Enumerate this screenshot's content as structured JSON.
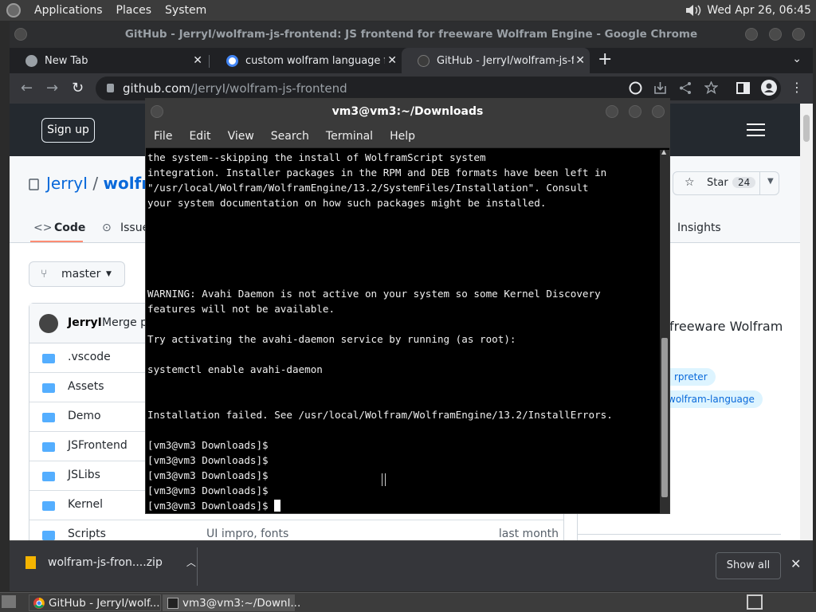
{
  "top_panel": {
    "menus": [
      "Applications",
      "Places",
      "System"
    ],
    "clock": "Wed Apr 26, 06:45"
  },
  "chrome": {
    "window_title": "GitHub - JerryI/wolfram-js-frontend: JS frontend for freeware Wolfram Engine - Google Chrome",
    "tabs": [
      {
        "label": "New Tab",
        "active": false
      },
      {
        "label": "custom wolfram language fro",
        "active": false
      },
      {
        "label": "GitHub - JerryI/wolfram-js-fro",
        "active": true
      }
    ],
    "url": {
      "host": "github.com",
      "path": "/JerryI/wolfram-js-frontend"
    }
  },
  "github": {
    "signup_label": "Sign up",
    "owner": "JerryI",
    "sep": " / ",
    "repo_partial": "wolfra",
    "star_label": "Star",
    "star_count": "24",
    "nav": {
      "code": "Code",
      "issues": "Issue",
      "insights": "Insights"
    },
    "branch": "master",
    "commit_author": "JerryI",
    "commit_msg": "Merge p",
    "files": [
      {
        "name": ".vscode",
        "msg": "",
        "date": ""
      },
      {
        "name": "Assets",
        "msg": "",
        "date": ""
      },
      {
        "name": "Demo",
        "msg": "",
        "date": ""
      },
      {
        "name": "JSFrontend",
        "msg": "",
        "date": ""
      },
      {
        "name": "JSLibs",
        "msg": "",
        "date": ""
      },
      {
        "name": "Kernel",
        "msg": "",
        "date": ""
      },
      {
        "name": "Scripts",
        "msg": "UI impro, fonts",
        "date": "last month"
      }
    ],
    "about_text": "freeware Wolfram",
    "topics": [
      "rpreter",
      "wolfram-language"
    ]
  },
  "downloads": {
    "file": "wolfram-js-fron....zip",
    "show_all": "Show all"
  },
  "terminal": {
    "title": "vm3@vm3:~/Downloads",
    "menu": [
      "File",
      "Edit",
      "View",
      "Search",
      "Terminal",
      "Help"
    ],
    "lines": [
      "the system--skipping the install of WolframScript system",
      "integration. Installer packages in the RPM and DEB formats have been left in",
      "\"/usr/local/Wolfram/WolframEngine/13.2/SystemFiles/Installation\". Consult",
      "your system documentation on how such packages might be installed.",
      "",
      "",
      "",
      "",
      "",
      "WARNING: Avahi Daemon is not active on your system so some Kernel Discovery",
      "features will not be available.",
      "",
      "Try activating the avahi-daemon service by running (as root):",
      "",
      "systemctl enable avahi-daemon",
      "",
      "",
      "Installation failed. See /usr/local/Wolfram/WolframEngine/13.2/InstallErrors.",
      "",
      "[vm3@vm3 Downloads]$",
      "[vm3@vm3 Downloads]$",
      "[vm3@vm3 Downloads]$",
      "[vm3@vm3 Downloads]$"
    ],
    "prompt": "[vm3@vm3 Downloads]$ "
  },
  "taskbar": {
    "tasks": [
      "GitHub - JerryI/wolf...",
      "vm3@vm3:~/Downl..."
    ]
  }
}
